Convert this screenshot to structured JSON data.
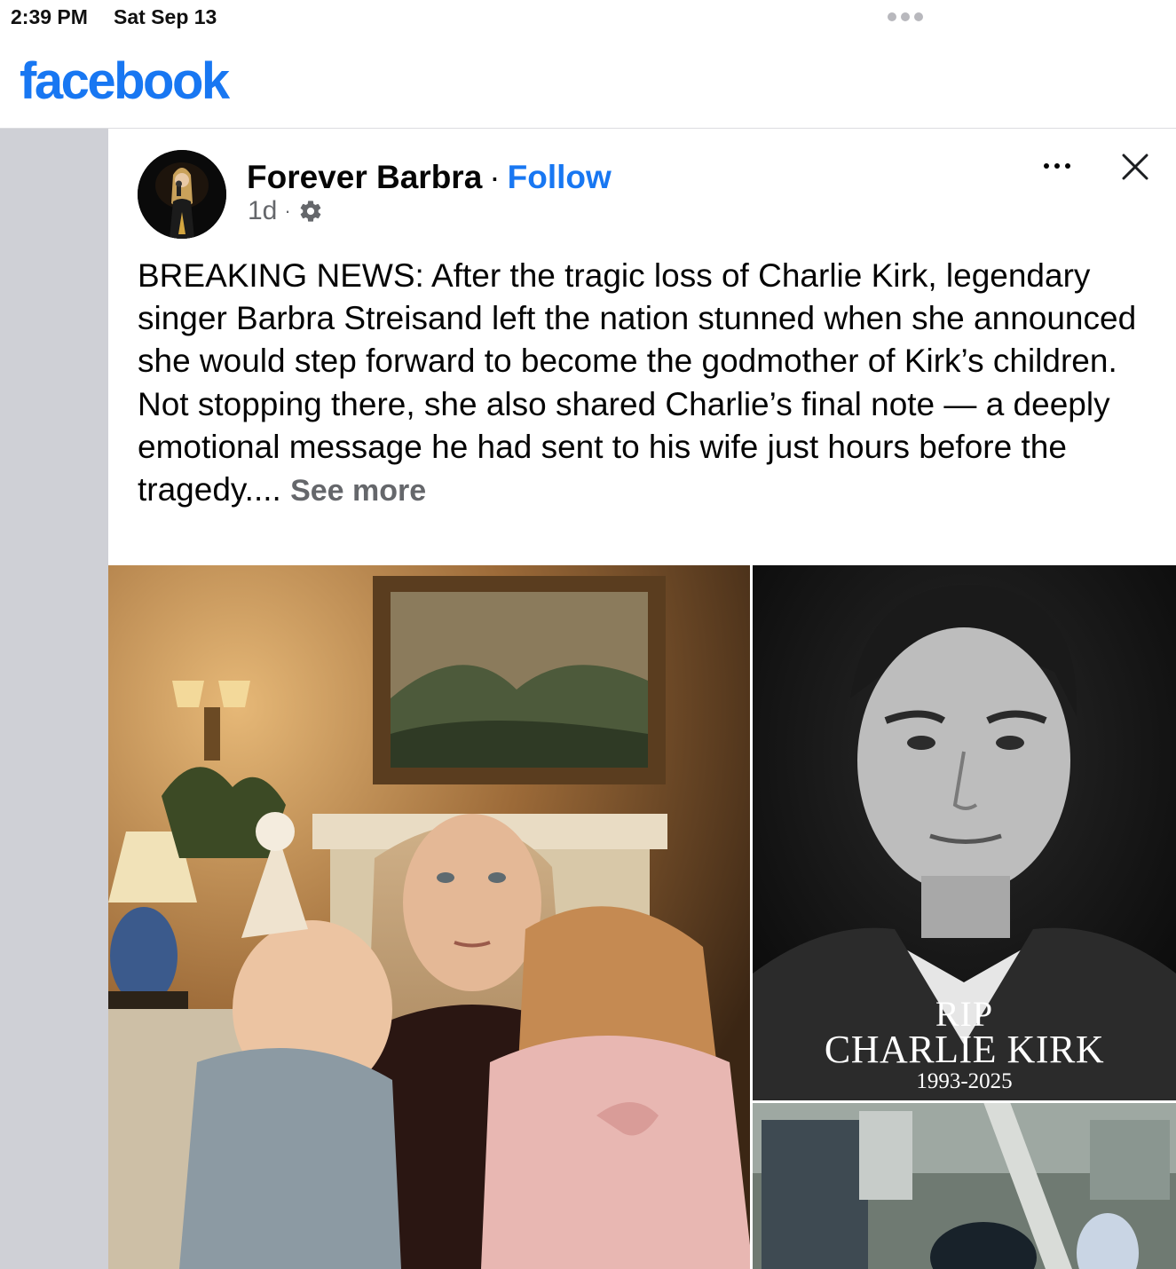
{
  "status_bar": {
    "time": "2:39 PM",
    "date": "Sat Sep 13"
  },
  "header": {
    "logo_text": "facebook",
    "brand_color": "#1877f2"
  },
  "post": {
    "author": "Forever Barbra",
    "separator": "·",
    "follow_label": "Follow",
    "age": "1d",
    "meta_separator": "·",
    "privacy_icon": "gear-icon",
    "more_icon": "more-horizontal-icon",
    "close_icon": "close-icon",
    "text_paragraph_1": "BREAKING NEWS: After the tragic loss of Charlie Kirk, legendary singer Barbra Streisand left the nation stunned when she announced she would step forward to become the godmother of Kirk’s children.",
    "text_paragraph_2": "Not stopping there, she also shared Charlie’s final note — a deeply emotional message he had sent to his wife just hours before the tragedy.... ",
    "see_more_label": "See more",
    "media": {
      "right_top_caption_line_1": "RIP",
      "right_top_caption_line_2": "CHARLIE KIRK",
      "right_top_caption_line_3": "1993-2025"
    }
  }
}
